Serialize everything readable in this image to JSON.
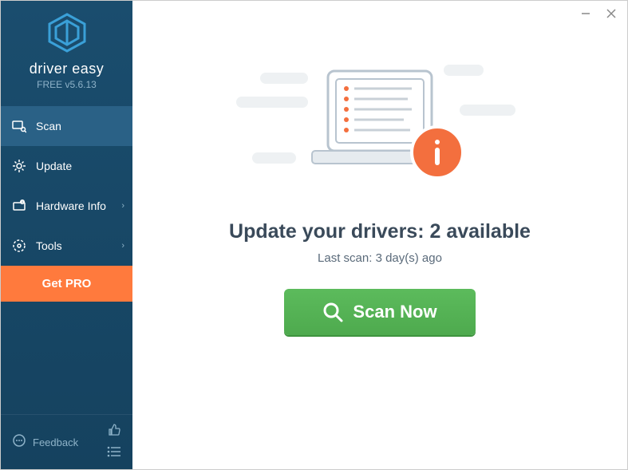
{
  "brand": {
    "name": "driver easy",
    "version": "FREE v5.6.13"
  },
  "sidebar": {
    "items": [
      {
        "label": "Scan",
        "active": true,
        "icon": "search"
      },
      {
        "label": "Update",
        "active": false,
        "icon": "gear"
      },
      {
        "label": "Hardware Info",
        "active": false,
        "icon": "hw",
        "chevron": true
      },
      {
        "label": "Tools",
        "active": false,
        "icon": "tools",
        "chevron": true
      }
    ],
    "get_pro": "Get PRO",
    "feedback": "Feedback"
  },
  "main": {
    "headline": "Update your drivers: 2 available",
    "last_scan": "Last scan: 3 day(s) ago",
    "scan_button": "Scan Now"
  },
  "colors": {
    "sidebar_bg": "#1a4d6e",
    "accent_orange": "#ff7a3d",
    "scan_green": "#5cbb5c",
    "info_orange": "#f36f3e"
  }
}
